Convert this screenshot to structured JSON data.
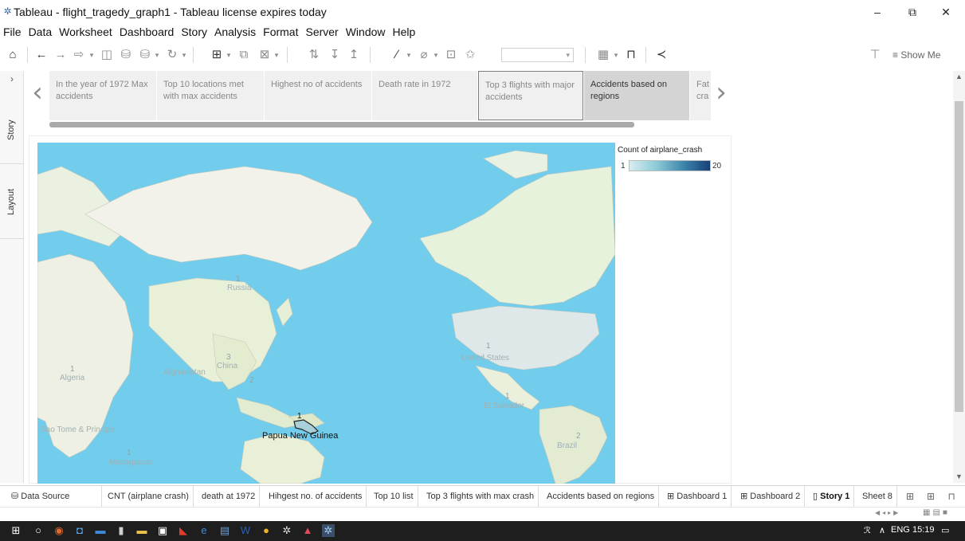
{
  "window": {
    "title": "Tableau - flight_tragedy_graph1 - Tableau license expires today",
    "minimize": "–",
    "restore": "⧉",
    "close": "✕"
  },
  "menu": [
    "File",
    "Data",
    "Worksheet",
    "Dashboard",
    "Story",
    "Analysis",
    "Format",
    "Server",
    "Window",
    "Help"
  ],
  "toolbar": {
    "show_me_label": "Show Me",
    "icons": [
      "home-icon",
      "undo-icon",
      "redo-icon",
      "return-icon",
      "save-icon",
      "new-datasource-icon",
      "pause-updates-icon",
      "run-update-icon",
      "new-worksheet-icon",
      "duplicate-sheet-icon",
      "clear-sheet-icon",
      "swap-icon",
      "sort-asc-icon",
      "sort-desc-icon",
      "highlight-icon",
      "group-icon",
      "show-labels-icon",
      "fix-axes-icon",
      "fit-dropdown",
      "show-cards-icon",
      "presentation-icon",
      "share-icon"
    ]
  },
  "side_tabs": {
    "story": "Story",
    "layout": "Layout"
  },
  "story_points": [
    {
      "text": "In the year of 1972 Max accidents"
    },
    {
      "text": "Top 10 locations met with max accidents"
    },
    {
      "text": "Highest no of accidents"
    },
    {
      "text": "Death rate in 1972"
    },
    {
      "text": "Top 3 flights with major accidents"
    },
    {
      "text": "Accidents based on regions"
    },
    {
      "text": "Fat cra"
    }
  ],
  "map": {
    "country_labels": [
      "Russia",
      "China",
      "Afghanistan",
      "Algeria",
      "Sao Tome & Principe",
      "Madagascar",
      "United States",
      "El Salvador",
      "Brazil"
    ],
    "count_labels": [
      "1",
      "3",
      "2",
      "1",
      "1",
      "1",
      "2",
      "1"
    ],
    "highlight_label": "Papua New Guinea",
    "highlight_count": "1"
  },
  "legend": {
    "title": "Count of airplane_crash",
    "min": "1",
    "max": "20",
    "color_low": "#d7edf0",
    "color_high": "#183e78"
  },
  "sheet_tabs": {
    "data_source": "Data Source",
    "tabs": [
      "CNT (airplane crash)",
      "death  at 1972",
      "Hihgest no. of accidents",
      "Top 10 list",
      "Top 3 flights with max crash",
      "Accidents based on regions",
      "Dashboard 1",
      "Dashboard 2",
      "Story 1",
      "Sheet 8"
    ],
    "active": "Story 1"
  },
  "tray": {
    "lang": "ENG",
    "time": "15:19"
  }
}
